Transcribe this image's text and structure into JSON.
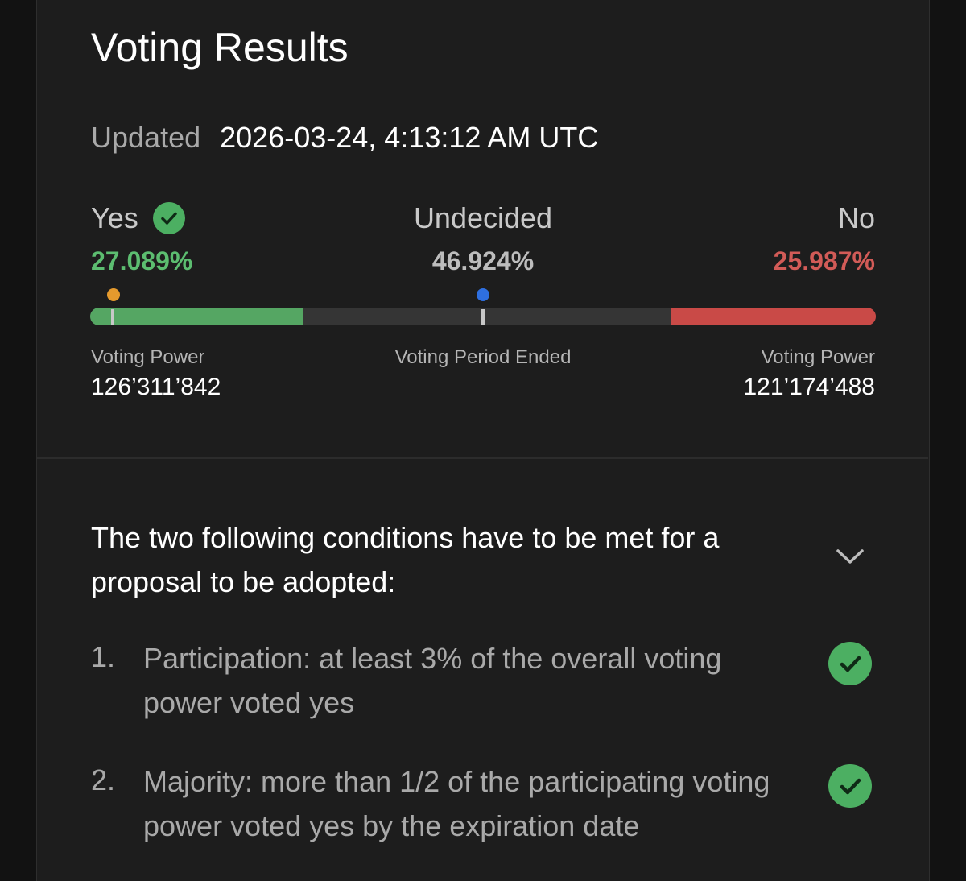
{
  "header": {
    "title": "Voting Results",
    "updated_label": "Updated",
    "updated_value": "2026-03-24, 4:13:12 AM UTC"
  },
  "results": {
    "yes": {
      "label": "Yes",
      "percent": "27.089%",
      "fraction": 0.27089,
      "color": "#55a663",
      "icon": "check-circle-icon"
    },
    "undecided": {
      "label": "Undecided",
      "percent": "46.924%",
      "fraction": 0.46924
    },
    "no": {
      "label": "No",
      "percent": "25.987%",
      "fraction": 0.25987,
      "color": "#c94a47"
    },
    "markers": {
      "orange_color": "#e59a2d",
      "blue_color": "#2e6fe0"
    },
    "left_power_label": "Voting Power",
    "left_power_value": "126’311’842",
    "status": "Voting Period Ended",
    "right_power_label": "Voting Power",
    "right_power_value": "121’174’488"
  },
  "conditions": {
    "intro": "The two following conditions have to be met for a proposal to be adopted:",
    "toggle_icon": "chevron-down-icon",
    "items": [
      {
        "number": "1.",
        "text": "Participation: at least 3% of the overall voting power voted yes",
        "met": true,
        "icon": "check-circle-icon"
      },
      {
        "number": "2.",
        "text": "Majority: more than 1/2 of the participating voting power voted yes by the expiration date",
        "met": true,
        "icon": "check-circle-icon"
      }
    ]
  }
}
